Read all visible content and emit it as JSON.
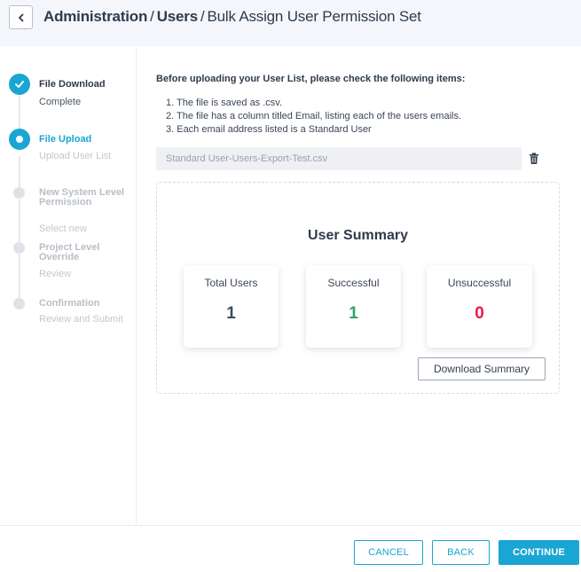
{
  "header": {
    "breadcrumb_1": "Administration",
    "breadcrumb_2": "Users",
    "breadcrumb_3": "Bulk Assign User Permission Set",
    "separator": "/"
  },
  "stepper": {
    "steps": [
      {
        "title": "File Download",
        "subtitle": "Complete",
        "state": "done"
      },
      {
        "title": "File Upload",
        "subtitle": "Upload User List",
        "state": "active"
      },
      {
        "title": "New System Level Permission",
        "subtitle": "Select new",
        "state": "pending"
      },
      {
        "title": "Project Level Override",
        "subtitle": "Review",
        "state": "pending"
      },
      {
        "title": "Confirmation",
        "subtitle": "Review and Submit",
        "state": "pending"
      }
    ]
  },
  "instructions": {
    "title": "Before uploading your User List, please check the following items:",
    "items": [
      "1. The file is saved as .csv.",
      "2. The file has a column titled Email, listing each of the users emails.",
      "3. Each email address listed is a Standard User"
    ]
  },
  "upload": {
    "file_name": "Standard User-Users-Export-Test.csv",
    "delete_icon": "trash-icon"
  },
  "summary": {
    "title": "User Summary",
    "cards": [
      {
        "label": "Total Users",
        "value": "1",
        "color": "#3d4a5c"
      },
      {
        "label": "Successful",
        "value": "1",
        "color": "#2fa36b"
      },
      {
        "label": "Unsuccessful",
        "value": "0",
        "color": "#e8174f"
      }
    ],
    "download_label": "Download Summary"
  },
  "footer": {
    "cancel_label": "CANCEL",
    "back_label": "BACK",
    "continue_label": "CONTINUE"
  },
  "colors": {
    "accent": "#1aa6d4",
    "success": "#2fa36b",
    "error": "#e8174f"
  }
}
